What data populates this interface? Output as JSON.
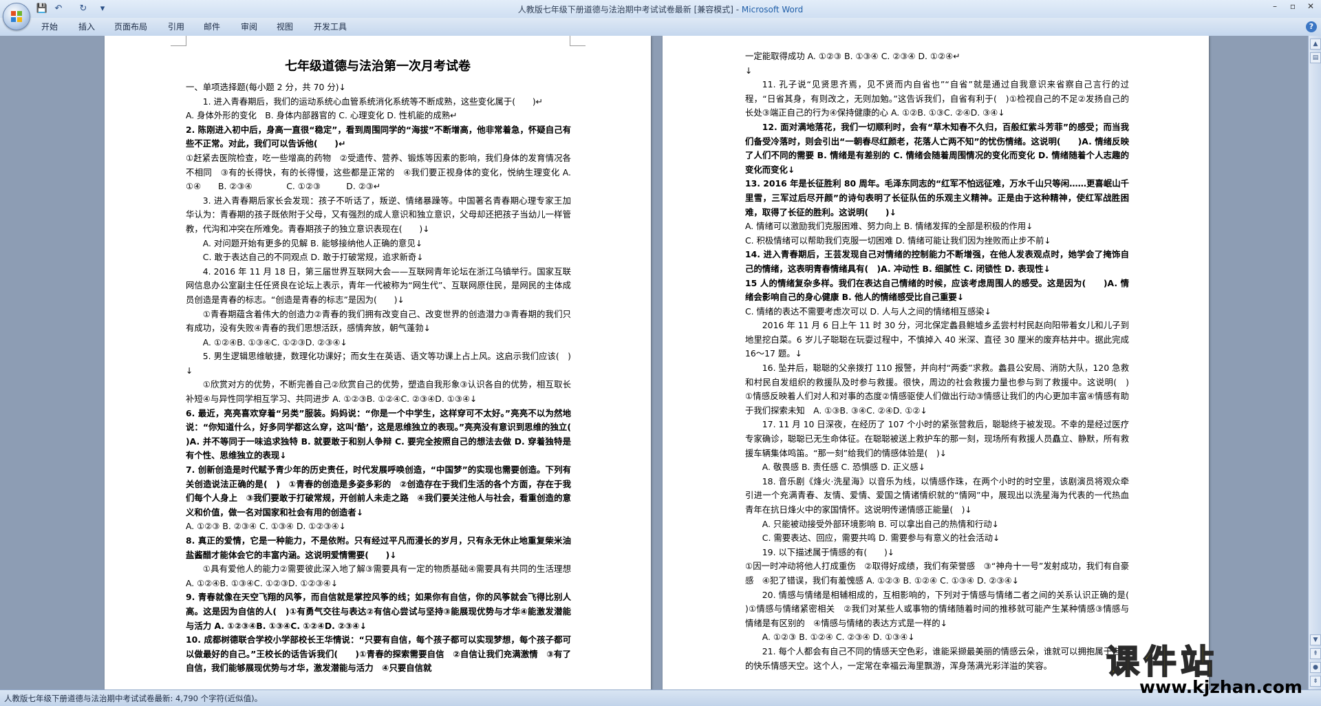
{
  "window": {
    "title_doc": "人教版七年级下册道德与法治期中考试试卷最新 [兼容模式] - ",
    "title_app": "Microsoft Word"
  },
  "qat": {
    "save": "💾",
    "undo": "↶",
    "redo": "↻",
    "more": "▾"
  },
  "ribbon": {
    "tabs": [
      "开始",
      "插入",
      "页面布局",
      "引用",
      "邮件",
      "审阅",
      "视图",
      "开发工具"
    ]
  },
  "doc": {
    "title": "七年级道德与法治第一次月考试卷",
    "left_lines": [
      {
        "t": "一、单项选择题(每小题 2 分，共 70 分)↓",
        "c": ""
      },
      {
        "t": "1. 进入青春期后，我们的运动系统心血管系统消化系统等不断成熟，这些变化属于(　　)↵",
        "c": "ind"
      },
      {
        "t": "A. 身体外形的变化　B. 身体内部器官的 C. 心理变化 D. 性机能的成熟↵",
        "c": ""
      },
      {
        "t": "2. 陈刚进入初中后，身高一直很“稳定”，看到周围同学的“海拔”不断增高，他非常着急，怀疑自己有些不正常。对此，我们可以告诉他(　　)↵",
        "c": "q"
      },
      {
        "t": "①赶紧去医院检查，吃一些增高的药物　②受遗传、营养、锻炼等因素的影响，我们身体的发育情况各不相同　③有的长得快，有的长得慢，这些都是正常的　④我们要正视身体的变化，悦纳生理变化 A. ①④　　B. ②③④　　　　C. ①②③　　　D. ②③↵",
        "c": ""
      },
      {
        "t": "3. 进入青春期后家长会发现：孩子不听话了，叛逆、情绪暴躁等。中国著名青春期心理专家王加华认为：青春期的孩子既依附于父母，又有强烈的成人意识和独立意识，父母却还把孩子当幼儿一样管教，代沟和冲突在所难免。青春期孩子的独立意识表现在(　　)↓",
        "c": "ind"
      },
      {
        "t": "A. 对问题开始有更多的见解 B. 能够接纳他人正确的意见↓",
        "c": "ind"
      },
      {
        "t": "C. 敢于表达自己的不同观点 D. 敢于打破常规，追求新奇↓",
        "c": "ind"
      },
      {
        "t": "4. 2016 年 11 月 18 日，第三届世界互联网大会——互联网青年论坛在浙江乌镇举行。国家互联网信息办公室副主任任贤良在论坛上表示，青年一代被称为“网生代”、互联网原住民，是网民的主体成员创造是青春的标志。“创造是青春的标志”是因为(　　)↓",
        "c": "ind"
      },
      {
        "t": "①青春期蕴含着伟大的创造力②青春的我们拥有改变自己、改变世界的创造潜力③青春期的我们只有成功，没有失败④青春的我们思想活跃，感情奔放，朝气蓬勃↓",
        "c": "ind"
      },
      {
        "t": "A. ①②④B. ①③④C. ①②③D. ②③④↓",
        "c": "ind"
      },
      {
        "t": "5. 男生逻辑思维敏捷，数理化功课好；而女生在英语、语文等功课上占上风。这启示我们应该(　)↓",
        "c": "ind"
      },
      {
        "t": "①欣赏对方的优势，不断完善自己②欣赏自己的优势，塑造自我形象③认识各自的优势，相互取长补短④与异性同学相互学习、共同进步 A. ①②③B. ①②④C. ②③④D. ①③④↓",
        "c": "ind"
      },
      {
        "t": "6. 最近，亮亮喜欢穿着“另类”服装。妈妈说：“你是一个中学生，这样穿可不太好。”亮亮不以为然地说：“你知道什么，好多同学都这么穿，这叫‘酷’，这是思维独立的表现。”亮亮没有意识到思维的独立(　　)A. 并不等同于一味追求独特 B. 就要敢于和别人争辩 C. 要完全按照自己的想法去做 D. 穿着独特是有个性、思维独立的表现↓",
        "c": "q"
      },
      {
        "t": "7. 创新创造是时代赋予青少年的历史责任，时代发展呼唤创造，“中国梦”的实现也需要创造。下列有关创造说法正确的是(　)　①青春的创造是多姿多彩的　②创造存在于我们生活的各个方面，存在于我们每个人身上　③我们要敢于打破常规，开创前人未走之路　④我们要关注他人与社会，看重创造的意义和价值，做一名对国家和社会有用的创造者↓",
        "c": "q"
      },
      {
        "t": "A. ①②③ B. ②③④ C. ①③④ D. ①②③④↓",
        "c": ""
      },
      {
        "t": "8. 真正的爱情，它是一种能力，不是依附。只有经过平凡而漫长的岁月，只有永无休止地重复柴米油盐酱醋才能体会它的丰富内涵。这说明爱情需要(　　)↓",
        "c": "q"
      },
      {
        "t": "①具有爱他人的能力②需要彼此深入地了解③需要具有一定的物质基础④需要具有共同的生活理想 A. ①②④B. ①③④C. ①②③D. ①②③④↓",
        "c": "ind"
      },
      {
        "t": "9. 青春就像在天空飞翔的风筝，而自信就是掌控风筝的线；如果你有自信，你的风筝就会飞得比别人高。这是因为自信的人(　)①有勇气交往与表达②有信心尝试与坚持③能展现优势与才华④能激发潜能与活力 A. ①②③④B. ①③④C. ①②④D. ②③④↓",
        "c": "q"
      },
      {
        "t": "10. 成都树德联合学校小学部校长王华情说：“只要有自信，每个孩子都可以实现梦想，每个孩子都可以做最好的自己。”王校长的话告诉我们(　　)①青春的探索需要自信　②自信让我们充满激情　③有了自信，我们能够展现优势与才华，激发潜能与活力　④只要自信就",
        "c": "q"
      }
    ],
    "right_lines": [
      {
        "t": "一定能取得成功 A. ①②③ B. ①③④ C. ②③④ D. ①②④↵",
        "c": ""
      },
      {
        "t": "↓",
        "c": ""
      },
      {
        "t": "11. 孔子说“见贤思齐焉，见不贤而内自省也”“自省”就是通过自我意识来省察自己言行的过程，“日省其身，有则改之，无则加勉。”这告诉我们，自省有利于(　)①检视自己的不足②发扬自己的长处③端正自己的行为④保持健康的心 A. ①②B. ①③C. ②④D. ③④↓",
        "c": "ind"
      },
      {
        "t": "12. 面对满地落花，我们一切顺利时，会有“草木知春不久归，百般红紫斗芳菲”的感受；而当我们备受冷落时，则会引出“一朝春尽红颜老，花落人亡两不知”的忧伤情绪。这说明(　　)A. 情绪反映了人们不同的需要 B. 情绪是有差别的 C. 情绪会随着周围情况的变化而变化 D. 情绪随着个人志趣的变化而变化↓",
        "c": "q ind"
      },
      {
        "t": "13. 2016 年是长征胜利 80 周年。毛泽东同志的“红军不怕远征难，万水千山只等闲……更喜岷山千里雪，三军过后尽开颜”的诗句表明了长征队伍的乐观主义精神。正是由于这种精神，使红军战胜困难，取得了长征的胜利。这说明(　　)↓",
        "c": "q"
      },
      {
        "t": "A. 情绪可以激励我们克服困难、努力向上 B. 情绪发挥的全部是积极的作用↓",
        "c": ""
      },
      {
        "t": "C. 积极情绪可以帮助我们克服一切困难 D. 情绪可能让我们因为挫败而止步不前↓",
        "c": ""
      },
      {
        "t": "14. 进入青春期后，王芸发现自己对情绪的控制能力不断增强，在他人发表观点时，她学会了掩饰自己的情绪，这表明青春情绪具有(　)A. 冲动性 B. 细腻性 C. 闭锁性 D. 表现性↓",
        "c": "q"
      },
      {
        "t": "15 人的情绪复杂多样。我们在表达自己情绪的时候，应该考虑周围人的感受。这是因为(　　)A. 情绪会影响自己的身心健康 B. 他人的情绪感受比自己重要↓",
        "c": "q"
      },
      {
        "t": "C. 情绪的表达不需要考虑次可以 D. 人与人之间的情绪相互感染↓",
        "c": ""
      },
      {
        "t": "2016 年 11 月 6 日上午 11 时 30 分，河北保定蠡县鲍墟乡孟尝村村民赵向阳带着女儿和儿子到地里挖白菜。6 岁儿子聪聪在玩耍过程中，不慎掉入 40 米深、直径 30 厘米的废弃枯井中。据此完成 16～17 题。↓",
        "c": "ind"
      },
      {
        "t": "16. 坠井后，聪聪的父亲拨打 110 报警，并向村“两委”求救。蠡县公安局、消防大队，120 急救和村民自发组织的救援队及时参与救援。很快，周边的社会救援力量也参与到了救援中。这说明(　)　①情感反映着人们对人和对事的态度②情感驱使人们做出行动③情感让我们的内心更加丰富④情感有助于我们探索未知　A. ①③B. ③④C. ②④D. ①②↓",
        "c": "ind"
      },
      {
        "t": "17. 11 月 10 日深夜，在经历了 107 个小时的紧张营救后，聪聪终于被发现。不幸的是经过医疗专家确诊，聪聪已无生命体征。在聪聪被送上救护车的那一刻，现场所有救援人员矗立、静默，所有救援车辆集体鸣笛。“那一刻”给我们的情感体验是(　)↓",
        "c": "ind"
      },
      {
        "t": "A. 敬畏感 B. 责任感 C. 恐惧感 D. 正义感↓",
        "c": "ind"
      },
      {
        "t": "18. 音乐剧《烽火·洗星海》以音乐为线，以情感作珠，在两个小时的时空里，该剧演员将观众牵引进一个充满青春、友情、爱情、爱国之情诸情织就的“情网”中，展现出以洗星海为代表的一代热血青年在抗日烽火中的家国情怀。这说明传递情感正能量(　)↓",
        "c": "ind"
      },
      {
        "t": "A. 只能被动接受外部环境影响 B. 可以拿出自己的热情和行动↓",
        "c": "ind"
      },
      {
        "t": "C. 需要表达、回应，需要共鸣 D. 需要参与有意义的社会活动↓",
        "c": "ind"
      },
      {
        "t": "19. 以下描述属于情感的有(　　)↓",
        "c": "ind"
      },
      {
        "t": "①因一时冲动将他人打成重伤　②取得好成绩，我们有荣誉感　③“神舟十一号”发射成功，我们有自豪感　④犯了错误，我们有羞愧感 A. ①②③ B. ①②④ C. ①③④ D. ②③④↓",
        "c": ""
      },
      {
        "t": "20. 情感与情绪是相辅相成的，互相影响的，下列对于情感与情绪二者之间的关系认识正确的是(　　)①情感与情绪紧密相关　②我们对某些人或事物的情绪随着时间的推移就可能产生某种情感③情感与情绪是有区别的　④情感与情绪的表达方式是一样的↓",
        "c": "ind"
      },
      {
        "t": "A. ①②③ B. ①②④ C. ②③④ D. ①③④↓",
        "c": "ind"
      },
      {
        "t": "21. 每个人都会有自己不同的情感天空色彩，谁能采撷最美丽的情感云朵，谁就可以拥抱属于自己的快乐情感天空。这个人，一定常在幸福云海里飘游，浑身荡满光彩洋溢的笑容。",
        "c": "ind"
      }
    ]
  },
  "status": {
    "text": "人教版七年级下册道德与法治期中考试试卷最新: 4,790 个字符(近似值)。"
  },
  "watermark": {
    "cn": "课件站",
    "url": "www.kjzhan.com"
  },
  "colors": {
    "app_accent": "#1f5ea8",
    "workspace": "#8d9db4",
    "watermark_yellow": "#f5d200"
  }
}
